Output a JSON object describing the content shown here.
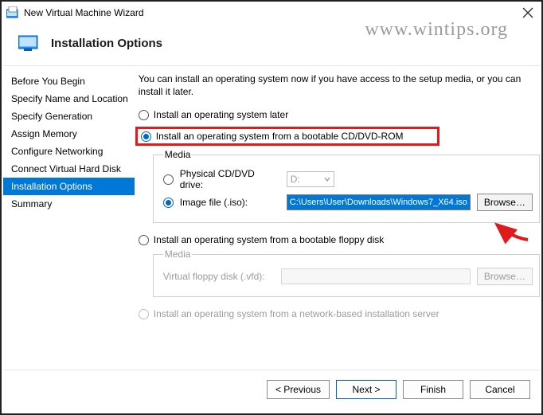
{
  "window": {
    "title": "New Virtual Machine Wizard"
  },
  "watermark": "www.wintips.org",
  "header": {
    "title": "Installation Options"
  },
  "steps": {
    "items": [
      {
        "label": "Before You Begin"
      },
      {
        "label": "Specify Name and Location"
      },
      {
        "label": "Specify Generation"
      },
      {
        "label": "Assign Memory"
      },
      {
        "label": "Configure Networking"
      },
      {
        "label": "Connect Virtual Hard Disk"
      },
      {
        "label": "Installation Options"
      },
      {
        "label": "Summary"
      }
    ],
    "activeIndex": 6
  },
  "main": {
    "description": "You can install an operating system now if you have access to the setup media, or you can install it later.",
    "opt_later": "Install an operating system later",
    "opt_cddvd": "Install an operating system from a bootable CD/DVD-ROM",
    "opt_floppy": "Install an operating system from a bootable floppy disk",
    "opt_network": "Install an operating system from a network-based installation server",
    "media_legend": "Media",
    "physical_label": "Physical CD/DVD drive:",
    "physical_value": "D:",
    "image_label": "Image file (.iso):",
    "image_value": "C:\\Users\\User\\Downloads\\Windows7_X64.iso",
    "browse_label": "Browse…",
    "vfd_label": "Virtual floppy disk (.vfd):"
  },
  "footer": {
    "previous": "< Previous",
    "next": "Next >",
    "finish": "Finish",
    "cancel": "Cancel"
  }
}
